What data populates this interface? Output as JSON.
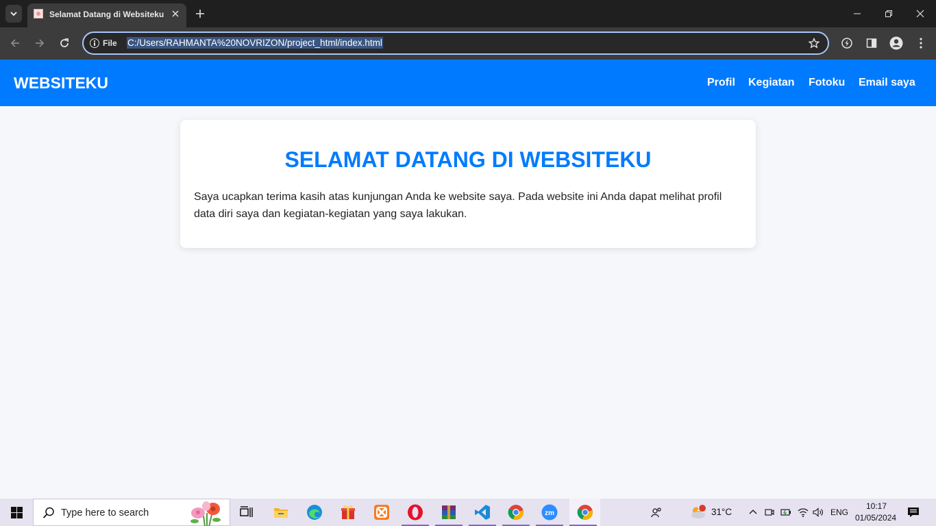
{
  "browser": {
    "tab_title": "Selamat Datang di Websiteku",
    "scheme_label": "File",
    "url": "C:/Users/RAHMANTA%20NOVRIZON/project_html/index.html"
  },
  "site": {
    "brand": "WEBSITEKU",
    "nav": [
      "Profil",
      "Kegiatan",
      "Fotoku",
      "Email saya"
    ],
    "heading": "SELAMAT DATANG DI WEBSITEKU",
    "paragraph": "Saya ucapkan terima kasih atas kunjungan Anda ke website saya. Pada website ini Anda dapat melihat profil data diri saya dan kegiatan-kegiatan yang saya lakukan.",
    "accent_color": "#007bff"
  },
  "taskbar": {
    "search_placeholder": "Type here to search",
    "temperature": "31°C",
    "weather_badge": "1",
    "language": "ENG",
    "time": "10:17",
    "date": "01/05/2024",
    "apps": [
      "task-view",
      "file-explorer",
      "edge",
      "gift-app",
      "xampp",
      "opera",
      "winrar",
      "vscode",
      "chrome",
      "zoom",
      "chrome-active"
    ]
  }
}
